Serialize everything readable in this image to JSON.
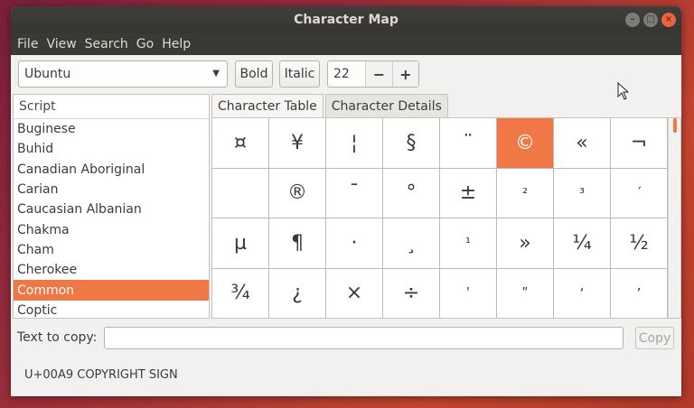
{
  "window": {
    "title": "Character Map"
  },
  "menu": [
    "File",
    "View",
    "Search",
    "Go",
    "Help"
  ],
  "toolbar": {
    "font": "Ubuntu",
    "bold_label": "Bold",
    "italic_label": "Italic",
    "size": "22",
    "minus": "−",
    "plus": "+"
  },
  "script_list": {
    "header": "Script",
    "items": [
      "Buginese",
      "Buhid",
      "Canadian Aboriginal",
      "Carian",
      "Caucasian Albanian",
      "Chakma",
      "Cham",
      "Cherokee",
      "Common",
      "Coptic"
    ],
    "selected": "Common"
  },
  "tabs": [
    "Character Table",
    "Character Details"
  ],
  "characters": [
    "¤",
    "¥",
    "¦",
    "§",
    "¨",
    "©",
    "«",
    "¬",
    "",
    "®",
    "¯",
    "°",
    "±",
    "²",
    "³",
    "´",
    "µ",
    "¶",
    "·",
    "¸",
    "¹",
    "»",
    "¼",
    "½",
    "¾",
    "¿",
    "×",
    "÷",
    "ʹ",
    "ʺ",
    "ʻ",
    "ʼ"
  ],
  "selected_character": "©",
  "copy": {
    "label": "Text to copy:",
    "value": "",
    "button": "Copy"
  },
  "status": "U+00A9 COPYRIGHT SIGN",
  "icons": {
    "minimize": "minimize-icon",
    "maximize": "maximize-icon",
    "close": "close-icon",
    "dropdown": "chevron-down-icon"
  },
  "colors": {
    "accent": "#f07746",
    "titlebar": "#3a3935",
    "window_bg": "#f2f1f0"
  }
}
